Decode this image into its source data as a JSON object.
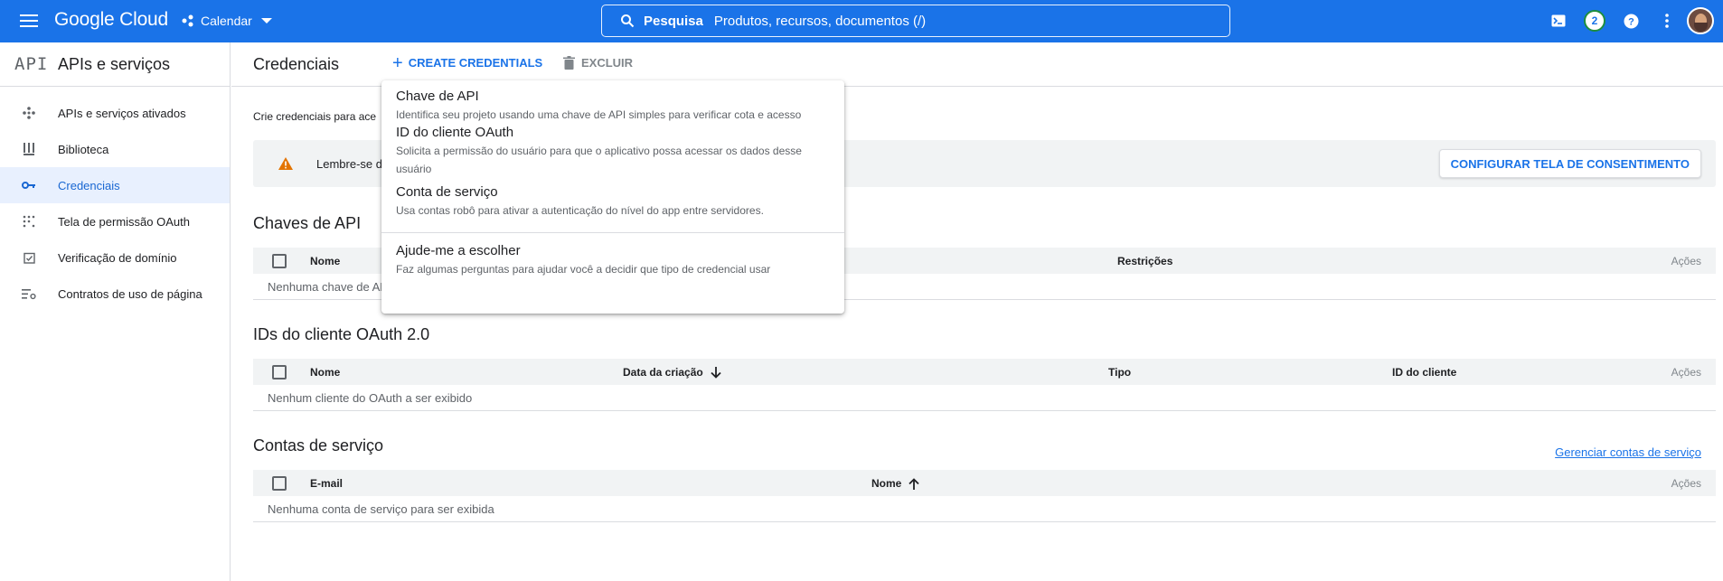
{
  "topbar": {
    "brand": "Google Cloud",
    "project": "Calendar",
    "search_label": "Pesquisa",
    "search_placeholder": "Produtos, recursos, documentos (/)",
    "notification_count": "2",
    "icons": [
      "menu-icon",
      "project-icon",
      "search-icon",
      "cloud-shell-icon",
      "help-icon",
      "more-vert-icon"
    ]
  },
  "sidebar": {
    "logo": "API",
    "title": "APIs e serviços",
    "items": [
      {
        "label": "APIs e serviços ativados",
        "icon": "apis-icon"
      },
      {
        "label": "Biblioteca",
        "icon": "library-icon"
      },
      {
        "label": "Credenciais",
        "icon": "key-icon",
        "active": true
      },
      {
        "label": "Tela de permissão OAuth",
        "icon": "oauth-icon"
      },
      {
        "label": "Verificação de domínio",
        "icon": "domain-check-icon"
      },
      {
        "label": "Contratos de uso de página",
        "icon": "settings-list-icon"
      }
    ]
  },
  "main": {
    "title": "Credenciais",
    "create_label": "CREATE CREDENTIALS",
    "delete_label": "EXCLUIR",
    "intro": "Crie credenciais para ace",
    "banner_text": "Lembre-se de",
    "consent_button": "CONFIGURAR TELA DE CONSENTIMENTO"
  },
  "dropdown": [
    {
      "title": "Chave de API",
      "desc": "Identifica seu projeto usando uma chave de API simples para verificar cota e acesso"
    },
    {
      "title": "ID do cliente OAuth",
      "desc": "Solicita a permissão do usuário para que o aplicativo possa acessar os dados desse usuário"
    },
    {
      "title": "Conta de serviço",
      "desc": "Usa contas robô para ativar a autenticação do nível do app entre servidores."
    },
    {
      "title": "Ajude-me a escolher",
      "desc": "Faz algumas perguntas para ajudar você a decidir que tipo de credencial usar"
    }
  ],
  "sections": {
    "api_keys": {
      "title": "Chaves de API",
      "columns": [
        "Nome",
        "Restrições",
        "Ações"
      ],
      "empty": "Nenhuma chave de AP"
    },
    "oauth": {
      "title": "IDs do cliente OAuth 2.0",
      "columns": [
        "Nome",
        "Data da criação",
        "Tipo",
        "ID do cliente",
        "Ações"
      ],
      "empty": "Nenhum cliente do OAuth a ser exibido"
    },
    "service_accounts": {
      "title": "Contas de serviço",
      "manage_link": "Gerenciar contas de serviço",
      "columns": [
        "E-mail",
        "Nome",
        "Ações"
      ],
      "empty": "Nenhuma conta de serviço para ser exibida"
    }
  },
  "colors": {
    "topbar": "#1a73e8",
    "accent": "#1a73e8",
    "active_bg": "#e8f0fe",
    "warning": "#e37400"
  }
}
